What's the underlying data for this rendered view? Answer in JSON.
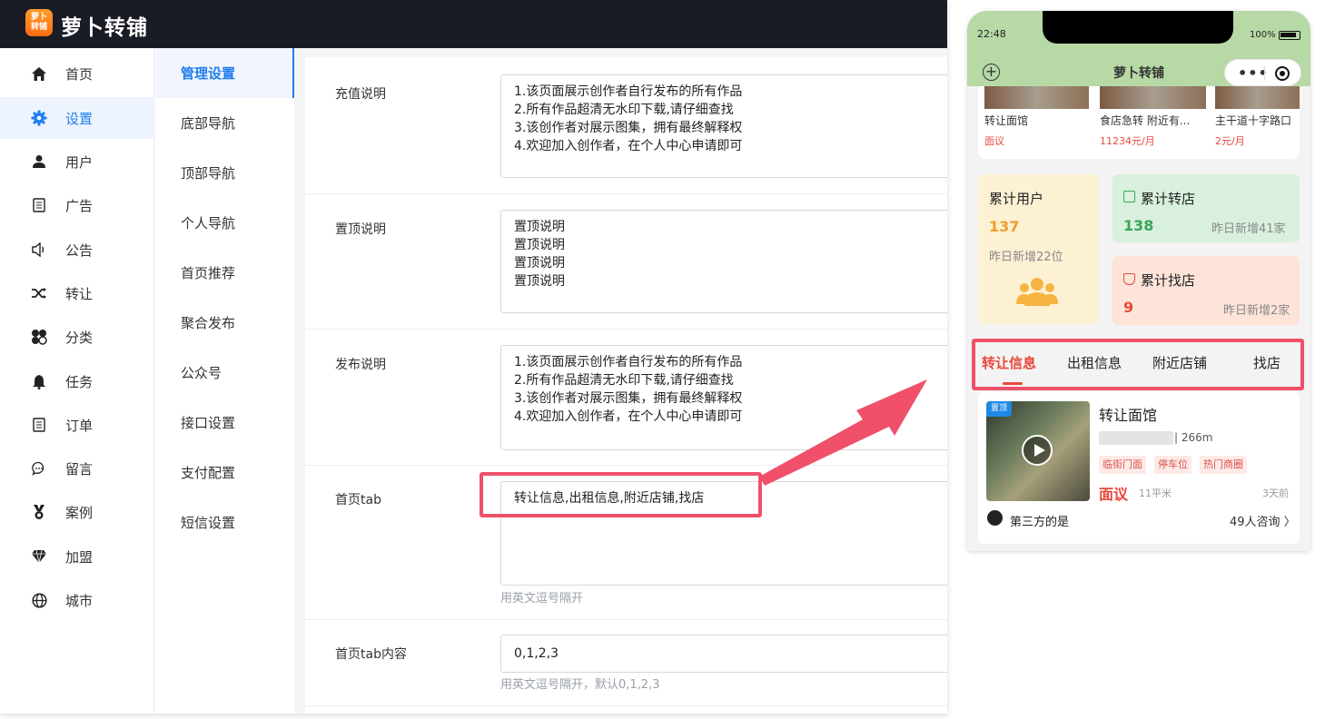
{
  "app": {
    "logo_text": "萝卜转铺",
    "title": "萝卜转铺"
  },
  "sidebar": {
    "items": [
      {
        "label": "首页",
        "icon": "home-icon"
      },
      {
        "label": "设置",
        "icon": "gear-icon",
        "active": true
      },
      {
        "label": "用户",
        "icon": "user-icon"
      },
      {
        "label": "广告",
        "icon": "ad-icon"
      },
      {
        "label": "公告",
        "icon": "speaker-icon"
      },
      {
        "label": "转让",
        "icon": "shuffle-icon"
      },
      {
        "label": "分类",
        "icon": "category-icon"
      },
      {
        "label": "任务",
        "icon": "bell-icon"
      },
      {
        "label": "订单",
        "icon": "order-icon"
      },
      {
        "label": "留言",
        "icon": "chat-icon"
      },
      {
        "label": "案例",
        "icon": "medal-icon"
      },
      {
        "label": "加盟",
        "icon": "diamond-icon"
      },
      {
        "label": "城市",
        "icon": "globe-icon"
      }
    ]
  },
  "subnav": {
    "items": [
      "管理设置",
      "底部导航",
      "顶部导航",
      "个人导航",
      "首页推荐",
      "聚合发布",
      "公众号",
      "接口设置",
      "支付配置",
      "短信设置"
    ]
  },
  "form": {
    "recharge": {
      "label": "充值说明",
      "lines": [
        "1.该页面展示创作者自行发布的所有作品",
        "2.所有作品超清无水印下载,请仔细查找",
        "3.该创作者对展示图集，拥有最终解释权",
        "4.欢迎加入创作者，在个人中心申请即可"
      ]
    },
    "pin": {
      "label": "置顶说明",
      "lines": [
        "置顶说明",
        "置顶说明",
        "置顶说明",
        "置顶说明"
      ]
    },
    "publish": {
      "label": "发布说明",
      "lines": [
        "1.该页面展示创作者自行发布的所有作品",
        "2.所有作品超清无水印下载,请仔细查找",
        "3.该创作者对展示图集，拥有最终解释权",
        "4.欢迎加入创作者，在个人中心申请即可"
      ]
    },
    "home_tab": {
      "label": "首页tab",
      "value": "转让信息,出租信息,附近店铺,找店",
      "hint": "用英文逗号隔开"
    },
    "home_tab_content": {
      "label": "首页tab内容",
      "value": "0,1,2,3",
      "hint": "用英文逗号隔开，默认0,1,2,3"
    }
  },
  "phone": {
    "time": "22:48",
    "battery": "100%",
    "title": "萝卜转铺",
    "listings": [
      {
        "name": "转让面馆",
        "price": "面议"
      },
      {
        "name": "食店急转 附近有...",
        "price": "11234元/月"
      },
      {
        "name": "主干道十字路口",
        "price": "2元/月"
      }
    ],
    "stats": {
      "users": {
        "title": "累计用户",
        "value": "137",
        "sub": "昨日新增22位",
        "color": "#f29b2b"
      },
      "transfer": {
        "title": "累计转店",
        "value": "138",
        "sub": "昨日新增41家",
        "color": "#3aa55a"
      },
      "find": {
        "title": "累计找店",
        "value": "9",
        "sub": "昨日新增2家",
        "color": "#e8473a"
      }
    },
    "tabs": [
      "转让信息",
      "出租信息",
      "附近店铺",
      "找店"
    ],
    "card": {
      "badge": "置顶",
      "title": "转让面馆",
      "distance": "| 266m",
      "tags": [
        "临街门面",
        "停车位",
        "热门商圈"
      ],
      "price": "面议",
      "area": "11平米",
      "ago": "3天前",
      "user": "第三方的是",
      "consult": "49人咨询 〉"
    }
  },
  "colors": {
    "accent": "#1e7ef0",
    "highlight": "#f0506a",
    "topbar": "#191b25"
  }
}
